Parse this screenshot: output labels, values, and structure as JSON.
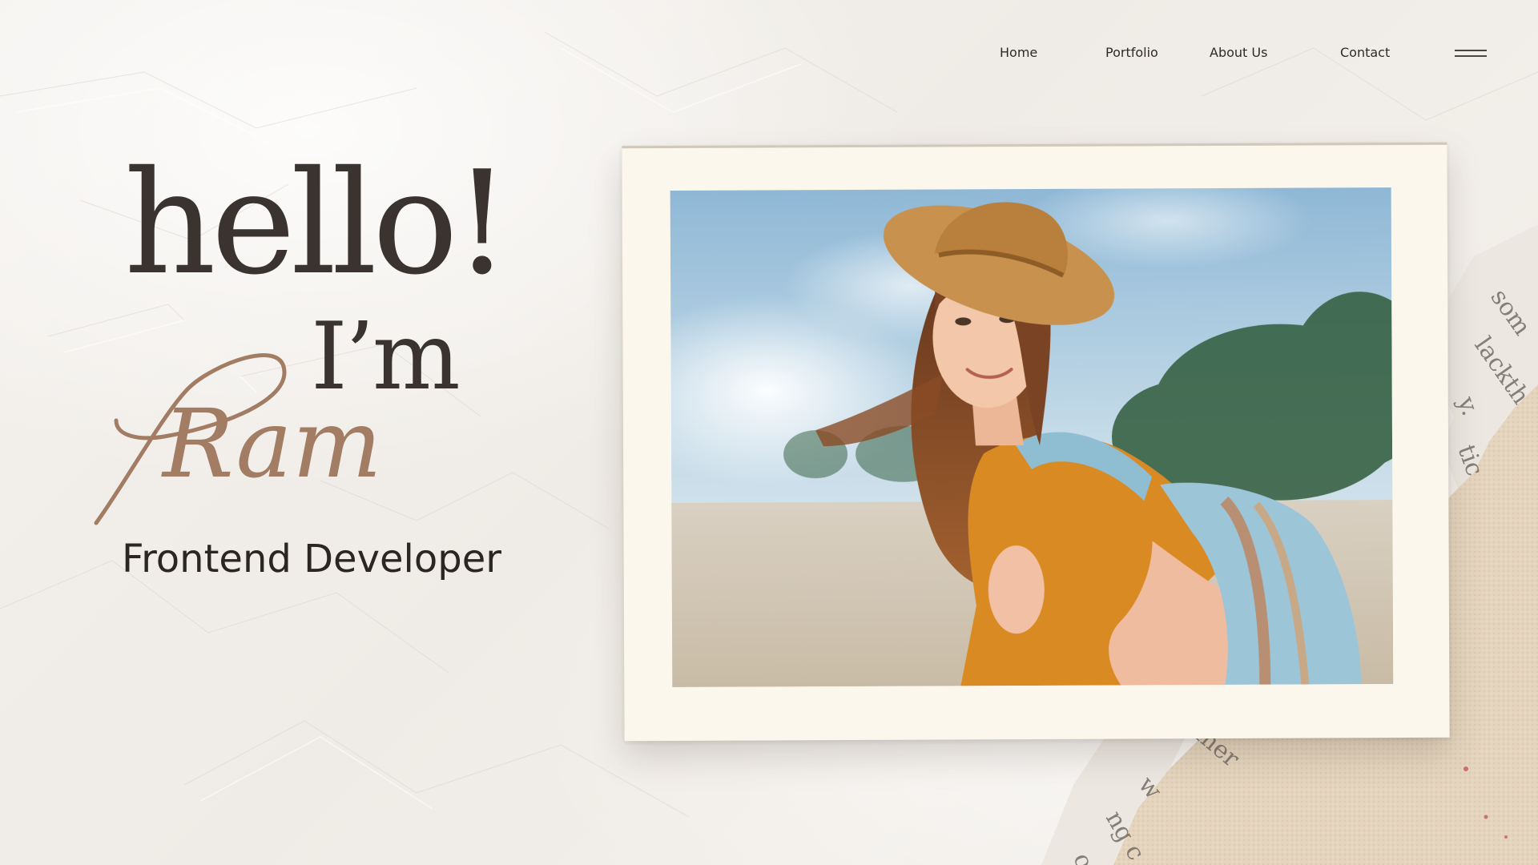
{
  "nav": {
    "items": [
      {
        "label": "Home"
      },
      {
        "label": "Portfolio"
      },
      {
        "label": "About Us"
      },
      {
        "label": "Contact"
      }
    ],
    "menu_icon": "hamburger-menu-icon"
  },
  "hero": {
    "greeting": "hello!",
    "intro": "I’m",
    "name": "Ram",
    "role": "Frontend Developer"
  },
  "photo": {
    "subject": "portrait-photo"
  },
  "colors": {
    "text_dark": "#3a3330",
    "accent_script": "#a27c63",
    "paper": "#f2efeb",
    "card": "#fbf7ec"
  }
}
